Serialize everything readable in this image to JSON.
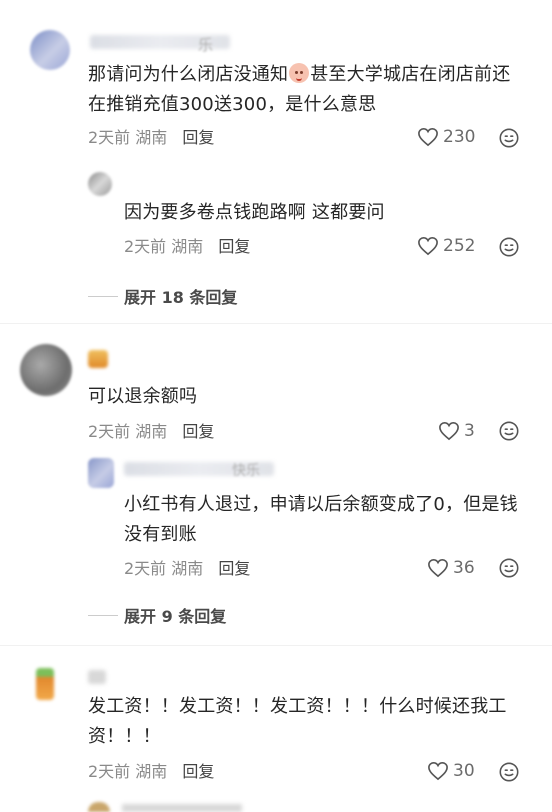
{
  "colors": {
    "meta_gray": "#8a8a8a",
    "text": "#262626",
    "reply": "#444444",
    "divider": "#f1f1f1"
  },
  "comments": [
    {
      "username": "乐",
      "text_part1": "那请问为什么闭店没通知",
      "emoji": "face-emoji",
      "text_part2": "甚至大学城店在闭店前还在推销充值300送300，是什么意思",
      "time": "2天前",
      "location": "湖南",
      "reply_label": "回复",
      "likes": "230",
      "reply": {
        "text": "因为要多卷点钱跑路啊 这都要问",
        "time": "2天前",
        "location": "湖南",
        "reply_label": "回复",
        "likes": "252"
      },
      "expand_label": "展开 18 条回复"
    },
    {
      "text": "可以退余额吗",
      "time": "2天前",
      "location": "湖南",
      "reply_label": "回复",
      "likes": "3",
      "reply": {
        "username": "快乐",
        "text": "小红书有人退过，申请以后余额变成了0，但是钱没有到账",
        "time": "2天前",
        "location": "湖南",
        "reply_label": "回复",
        "likes": "36"
      },
      "expand_label": "展开 9 条回复"
    },
    {
      "text": "发工资！！发工资！！发工资！！！什么时候还我工资！！！",
      "time": "2天前",
      "location": "湖南",
      "reply_label": "回复",
      "likes": "30"
    }
  ],
  "icons": {
    "like": "heart-outline-icon",
    "comment": "smiley-comment-icon"
  }
}
